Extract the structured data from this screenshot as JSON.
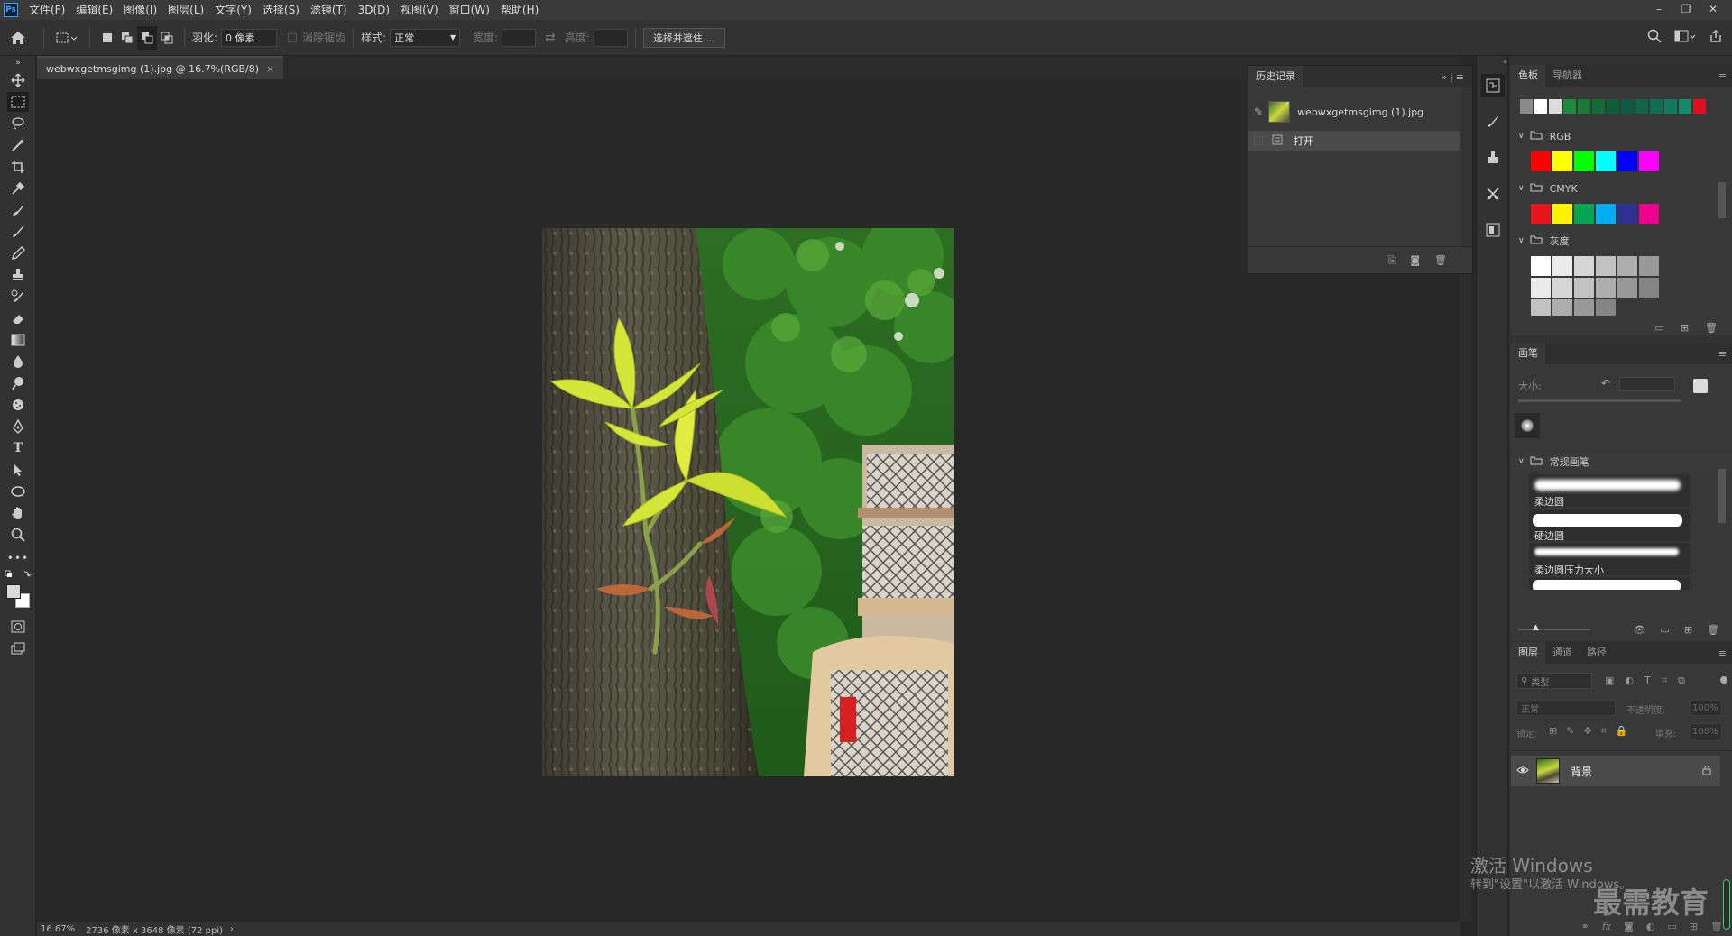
{
  "app": {
    "logo": "Ps"
  },
  "menu": [
    "文件(F)",
    "编辑(E)",
    "图像(I)",
    "图层(L)",
    "文字(Y)",
    "选择(S)",
    "滤镜(T)",
    "3D(D)",
    "视图(V)",
    "窗口(W)",
    "帮助(H)"
  ],
  "window_controls": {
    "minimize": "–",
    "restore": "❐",
    "close": "✕"
  },
  "options": {
    "feather_label": "羽化:",
    "feather_value": "0 像素",
    "antialias_label": "消除锯齿",
    "style_label": "样式:",
    "style_value": "正常",
    "width_label": "宽度:",
    "height_label": "高度:",
    "select_mask_button": "选择并遮住 ..."
  },
  "document": {
    "tab_title": "webwxgetmsgimg (1).jpg @ 16.7%(RGB/8)",
    "tab_close": "×"
  },
  "status": {
    "zoom": "16.67%",
    "info": "2736 像素 x 3648 像素 (72 ppi)",
    "arrow": "›"
  },
  "history": {
    "title": "历史记录",
    "snapshot_label": "webwxgetmsgimg (1).jpg",
    "items": [
      "打开"
    ]
  },
  "swatches": {
    "tabs": [
      "色板",
      "导航器"
    ],
    "recent_colors": [
      "#8a8a8a",
      "#ffffff",
      "#dcdcdc",
      "#1f8a3a",
      "#1a7a35",
      "#146b37",
      "#0f5e3a",
      "#0d5a40",
      "#106448",
      "#0f6b52",
      "#127a5e",
      "#158a6a",
      "#e0101c"
    ],
    "groups": [
      {
        "name": "RGB",
        "colors": [
          "#ff0000",
          "#ffff00",
          "#00ff00",
          "#00ffff",
          "#0000ff",
          "#ff00ff"
        ]
      },
      {
        "name": "CMYK",
        "colors": [
          "#e8141b",
          "#fff200",
          "#00a650",
          "#00aeef",
          "#2e3192",
          "#ec008c"
        ]
      },
      {
        "name": "灰度",
        "colors": [
          "#ffffff",
          "#ebebeb",
          "#d6d6d6",
          "#c2c2c2",
          "#adadad",
          "#999999",
          "#858585"
        ]
      }
    ]
  },
  "brushes": {
    "title": "画笔",
    "size_label": "大小:",
    "folder": "常规画笔",
    "items": [
      "柔边圆",
      "硬边圆",
      "柔边圆压力大小"
    ]
  },
  "layers": {
    "tabs": [
      "图层",
      "通道",
      "路径"
    ],
    "filter_label": "类型",
    "blend_mode": "正常",
    "opacity_label": "不透明度:",
    "opacity_value": "100%",
    "lock_label": "锁定:",
    "fill_label": "填充:",
    "fill_value": "100%",
    "layer_name": "背景"
  },
  "watermark": {
    "activate_line1": "激活 Windows",
    "activate_line2": "转到\"设置\"以激活 Windows。",
    "brand": "最需教育"
  },
  "colors": {
    "accent": "#31a8ff",
    "panel_bg": "#383838",
    "canvas_bg": "#282828"
  }
}
